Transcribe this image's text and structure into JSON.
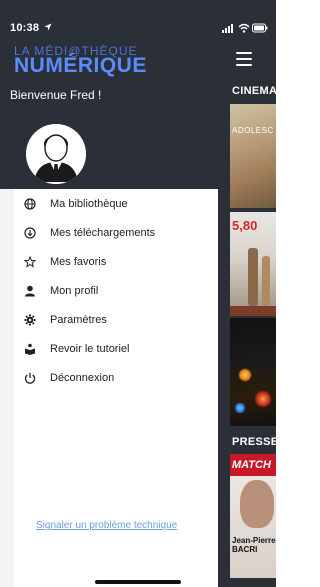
{
  "status": {
    "time": "10:38"
  },
  "brand": {
    "line1": "LA MÉDI@THÈQUE",
    "line2": "NUMÉRIQUE"
  },
  "welcome": "Bienvenue  Fred !",
  "menu": {
    "items": [
      {
        "label": "Ma bibliothèque",
        "icon": "globe-icon"
      },
      {
        "label": "Mes téléchargements",
        "icon": "download-icon"
      },
      {
        "label": "Mes favoris",
        "icon": "star-icon"
      },
      {
        "label": "Mon profil",
        "icon": "person-icon"
      },
      {
        "label": "Paramètres",
        "icon": "gear-icon"
      },
      {
        "label": "Revoir le tutoriel",
        "icon": "book-icon"
      },
      {
        "label": "Déconnexion",
        "icon": "power-icon"
      }
    ]
  },
  "report_link": "Signaler un problème technique",
  "behind": {
    "section1": "CINEMA",
    "section2": "PRESSE",
    "thumb1_text": "ADOLESC",
    "thumb2_price": "5,80",
    "thumb4_brand": "MATCH",
    "thumb4_name": "Jean-Pierre BACRI"
  },
  "colors": {
    "drawer_header": "#2b3038",
    "brand_blue": "#5a8cff",
    "link_blue": "#6aa0e0"
  }
}
